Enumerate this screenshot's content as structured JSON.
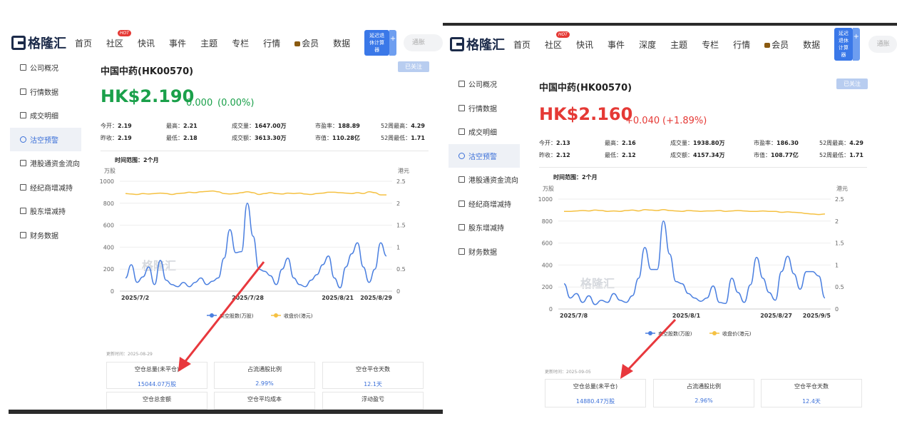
{
  "left": {
    "logo": "格隆汇",
    "nav": [
      "首页",
      "社区",
      "快讯",
      "事件",
      "主题",
      "专栏",
      "行情",
      "会员",
      "数据"
    ],
    "hot_badge": "HOT",
    "calc_label": "延迟退休计算器",
    "search_placeholder": "通胀",
    "sidebar": [
      "公司概况",
      "行情数据",
      "成交明细",
      "沽空预警",
      "港股通资金流向",
      "经纪商增减持",
      "股东增减持",
      "财务数据"
    ],
    "stock_name": "中国中药(HK00570)",
    "follow_label": "已关注",
    "price": "HK$2.190",
    "change": "0.000",
    "change_pct": "(0.00%)",
    "stats": [
      [
        {
          "k": "今开：",
          "v": "2.19",
          "c": "down"
        },
        {
          "k": "最高：",
          "v": "2.21",
          "c": "up"
        },
        {
          "k": "成交量：",
          "v": "1647.00万",
          "c": ""
        },
        {
          "k": "市盈率：",
          "v": "188.89",
          "c": ""
        },
        {
          "k": "52周最高：",
          "v": "4.29",
          "c": ""
        }
      ],
      [
        {
          "k": "昨收：",
          "v": "2.19",
          "c": ""
        },
        {
          "k": "最低：",
          "v": "2.18",
          "c": "down"
        },
        {
          "k": "成交额：",
          "v": "3613.30万",
          "c": ""
        },
        {
          "k": "市值：",
          "v": "110.28亿",
          "c": ""
        },
        {
          "k": "52周最低：",
          "v": "1.71",
          "c": ""
        }
      ]
    ],
    "range_label": "时间范围：2个月",
    "update_label": "更新时间：2025-08-29",
    "cards": [
      {
        "k": "空仓总量(未平仓)",
        "v": "15044.07万股"
      },
      {
        "k": "占流通股比例",
        "v": "2.99%"
      },
      {
        "k": "空仓平仓天数",
        "v": "12.1天"
      },
      {
        "k": "空仓总金额",
        "v": ""
      },
      {
        "k": "空仓平均成本",
        "v": ""
      },
      {
        "k": "浮动盈亏",
        "v": ""
      }
    ],
    "chart_data": {
      "type": "line",
      "ylabel_left": "万股",
      "ylabel_right": "港元",
      "ylim_left": [
        0,
        1000
      ],
      "ylim_right": [
        0,
        2.5
      ],
      "yticks_left": [
        "0",
        "200",
        "400",
        "600",
        "800",
        "1000"
      ],
      "yticks_right": [
        "0",
        "0.5",
        "1",
        "1.5",
        "2",
        "2.5"
      ],
      "x_labels": [
        "2025/7/2",
        "2025/7/28",
        "2025/8/21",
        "2025/8/29"
      ],
      "legend": [
        "卖空股数(万股)",
        "收盘价(港元)"
      ],
      "colors": {
        "short": "#4a7fe0",
        "close": "#f5c142"
      },
      "series": [
        {
          "name": "卖空股数(万股)",
          "axis": "left",
          "values": [
            120,
            240,
            80,
            130,
            220,
            60,
            280,
            100,
            60,
            40,
            80,
            40,
            80,
            120,
            60,
            90,
            120,
            300,
            560,
            350,
            360,
            800,
            500,
            200,
            180,
            140,
            60,
            200,
            300,
            120,
            60,
            40,
            100,
            150,
            240,
            320,
            120,
            30,
            220,
            340,
            440,
            220,
            80,
            200,
            440,
            320
          ]
        },
        {
          "name": "收盘价(港元)",
          "axis": "right",
          "values": [
            2.22,
            2.21,
            2.2,
            2.22,
            2.21,
            2.22,
            2.23,
            2.22,
            2.2,
            2.22,
            2.23,
            2.25,
            2.24,
            2.26,
            2.27,
            2.28,
            2.26,
            2.22,
            2.21,
            2.22,
            2.24,
            2.26,
            2.24,
            2.2,
            2.22,
            2.24,
            2.22,
            2.21,
            2.23,
            2.22,
            2.23,
            2.21,
            2.2,
            2.22,
            2.23,
            2.25,
            2.25,
            2.24,
            2.23,
            2.22,
            2.24,
            2.22,
            2.26,
            2.24,
            2.19,
            2.19
          ]
        }
      ]
    }
  },
  "right": {
    "logo": "格隆汇",
    "nav": [
      "首页",
      "社区",
      "快讯",
      "事件",
      "深度",
      "主题",
      "专栏",
      "行情",
      "会员",
      "数据"
    ],
    "hot_badge": "HOT",
    "calc_label": "延迟退休计算器",
    "search_placeholder": "通胀",
    "sidebar": [
      "公司概况",
      "行情数据",
      "成交明细",
      "沽空预警",
      "港股通资金流向",
      "经纪商增减持",
      "股东增减持",
      "财务数据"
    ],
    "stock_name": "中国中药(HK00570)",
    "follow_label": "已关注",
    "price": "HK$2.160",
    "change": "+0.040",
    "change_pct": "(+1.89%)",
    "stats": [
      [
        {
          "k": "今开：",
          "v": "2.13",
          "c": "up"
        },
        {
          "k": "最高：",
          "v": "2.16",
          "c": "up"
        },
        {
          "k": "成交量：",
          "v": "1938.80万",
          "c": ""
        },
        {
          "k": "市盈率：",
          "v": "186.30",
          "c": ""
        },
        {
          "k": "52周最高：",
          "v": "4.29",
          "c": ""
        }
      ],
      [
        {
          "k": "昨收：",
          "v": "2.12",
          "c": ""
        },
        {
          "k": "最低：",
          "v": "2.12",
          "c": "down"
        },
        {
          "k": "成交额：",
          "v": "4157.34万",
          "c": ""
        },
        {
          "k": "市值：",
          "v": "108.77亿",
          "c": ""
        },
        {
          "k": "52周最低：",
          "v": "1.71",
          "c": ""
        }
      ]
    ],
    "range_label": "时间范围：2个月",
    "update_label": "更新时间：2025-09-05",
    "cards": [
      {
        "k": "空仓总量(未平仓)",
        "v": "14880.47万股"
      },
      {
        "k": "占流通股比例",
        "v": "2.96%"
      },
      {
        "k": "空仓平仓天数",
        "v": "12.4天"
      }
    ],
    "chart_data": {
      "type": "line",
      "ylabel_left": "万股",
      "ylabel_right": "港元",
      "ylim_left": [
        0,
        1000
      ],
      "ylim_right": [
        0,
        2.5
      ],
      "yticks_left": [
        "0",
        "200",
        "400",
        "600",
        "800",
        "1000"
      ],
      "yticks_right": [
        "0",
        "0.5",
        "1",
        "1.5",
        "2",
        "2.5"
      ],
      "x_labels": [
        "2025/7/8",
        "2025/8/1",
        "2025/8/27",
        "2025/9/5"
      ],
      "legend": [
        "卖空股数(万股)",
        "收盘价(港元)"
      ],
      "colors": {
        "short": "#4a7fe0",
        "close": "#f5c142"
      },
      "series": [
        {
          "name": "卖空股数(万股)",
          "axis": "left",
          "values": [
            230,
            100,
            140,
            60,
            120,
            40,
            80,
            60,
            140,
            80,
            60,
            120,
            280,
            560,
            360,
            360,
            800,
            500,
            250,
            230,
            140,
            100,
            70,
            100,
            210,
            60,
            50,
            280,
            150,
            60,
            220,
            470,
            280,
            150,
            80,
            340,
            480,
            320,
            180,
            340,
            340,
            300,
            100
          ]
        },
        {
          "name": "收盘价(港元)",
          "axis": "right",
          "values": [
            2.22,
            2.22,
            2.23,
            2.24,
            2.23,
            2.25,
            2.24,
            2.22,
            2.23,
            2.22,
            2.24,
            2.25,
            2.23,
            2.26,
            2.25,
            2.24,
            2.26,
            2.24,
            2.23,
            2.22,
            2.24,
            2.23,
            2.22,
            2.23,
            2.23,
            2.24,
            2.22,
            2.23,
            2.24,
            2.23,
            2.22,
            2.22,
            2.23,
            2.22,
            2.22,
            2.2,
            2.21,
            2.2,
            2.19,
            2.17,
            2.16,
            2.15,
            2.16
          ]
        }
      ]
    }
  }
}
